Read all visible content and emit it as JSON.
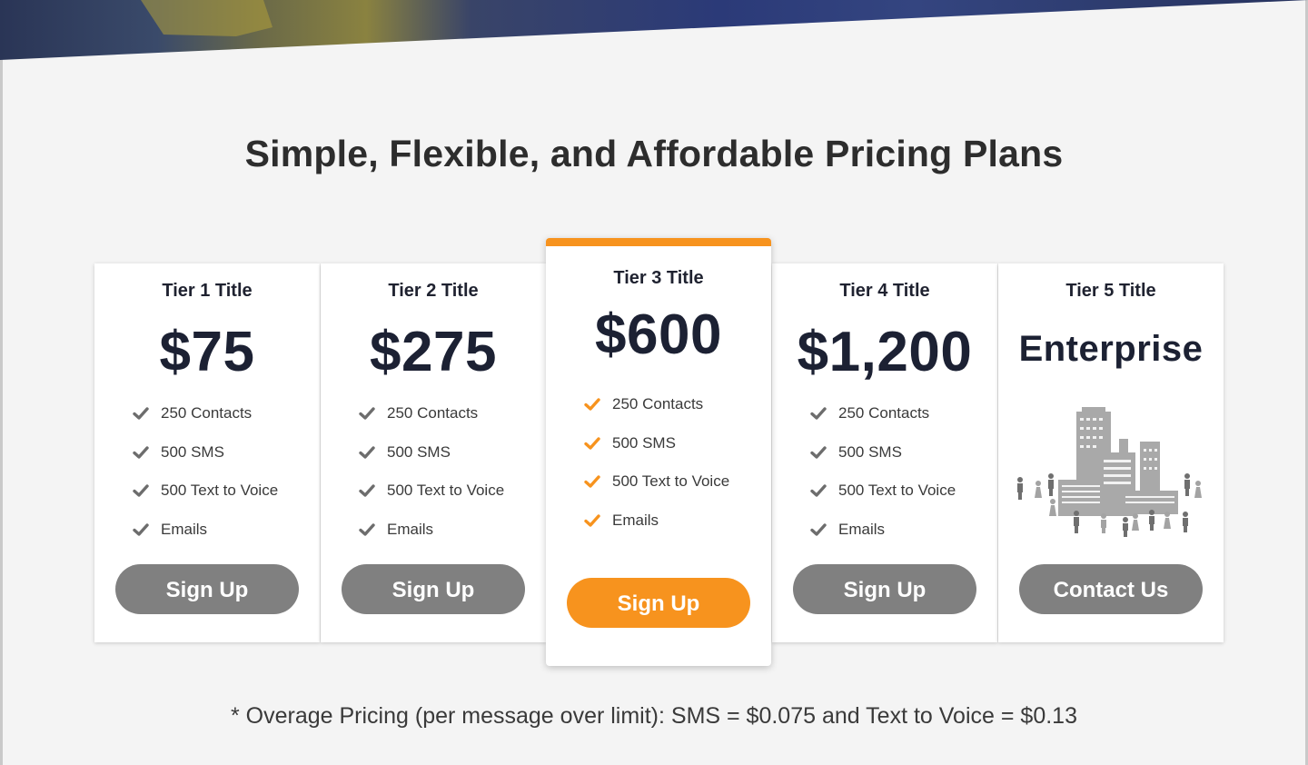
{
  "headline": "Simple, Flexible, and Affordable Pricing Plans",
  "colors": {
    "accent": "#f7931e",
    "button_default": "#808080",
    "heading": "#1c2133",
    "background": "#f4f4f4"
  },
  "tiers": [
    {
      "title": "Tier 1 Title",
      "price": "$75",
      "features": [
        "250 Contacts",
        "500 SMS",
        "500 Text to Voice",
        "Emails"
      ],
      "button": "Sign Up"
    },
    {
      "title": "Tier 2 Title",
      "price": "$275",
      "features": [
        "250 Contacts",
        "500 SMS",
        "500 Text to Voice",
        "Emails"
      ],
      "button": "Sign Up"
    },
    {
      "title": "Tier 3 Title",
      "price": "$600",
      "features": [
        "250 Contacts",
        "500 SMS",
        "500 Text to Voice",
        "Emails"
      ],
      "button": "Sign Up",
      "featured": true
    },
    {
      "title": "Tier 4 Title",
      "price": "$1,200",
      "features": [
        "250 Contacts",
        "500 SMS",
        "500 Text to Voice",
        "Emails"
      ],
      "button": "Sign Up"
    },
    {
      "title": "Tier 5 Title",
      "price": "Enterprise",
      "illustration": "city-people-icon",
      "button": "Contact Us"
    }
  ],
  "footnote": "* Overage Pricing (per message over limit): SMS = $0.075 and Text to Voice = $0.13"
}
